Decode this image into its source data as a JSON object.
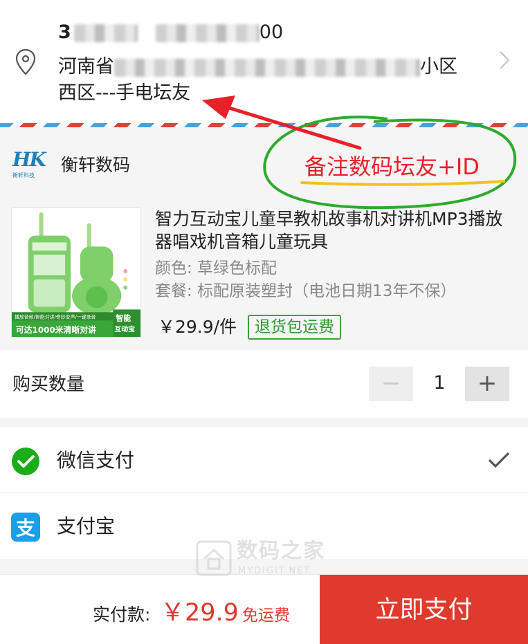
{
  "address": {
    "name_prefix": "3",
    "phone_suffix": "00",
    "line1_start": "河南省",
    "line1_end": "小区",
    "line2": "西区---手电坛友",
    "icons": {
      "location": "location-pin-icon",
      "arrow": "chevron-right-icon"
    }
  },
  "shop": {
    "logo_text": "HK",
    "logo_sub": "衡轩科技",
    "name": "衡轩数码"
  },
  "product": {
    "title": "智力互动宝儿童早教机故事机对讲机MP3播放器唱戏机音箱儿童玩具",
    "spec_color": "颜色: 草绿色标配",
    "spec_package": "套餐: 标配原装塑封（电池日期13年不保）",
    "price": "￥29.9/件",
    "tag": "退货包运费",
    "thumb": {
      "badge": "智能\n互动宝",
      "banner_small": "播放音频/智能对讲/奇妙变声/一键录音",
      "banner_big": "可达1000米清晰对讲"
    }
  },
  "quantity": {
    "label": "购买数量",
    "minus": "−",
    "value": "1",
    "plus": "+"
  },
  "payment": {
    "wechat_label": "微信支付",
    "alipay_label": "支付宝",
    "selected": "wechat",
    "colors": {
      "wechat": "#1aad19",
      "alipay": "#1a9fe8"
    }
  },
  "bottom": {
    "label": "实付款:",
    "price": "￥29.9",
    "shipping": "免运费",
    "button": "立即支付",
    "button_color": "#e03a2f"
  },
  "annotation": {
    "text": "备注数码坛友+ID",
    "color": "#e8202a"
  },
  "watermark": {
    "cn": "数码之家",
    "en": "MYDIGIT.NET"
  }
}
